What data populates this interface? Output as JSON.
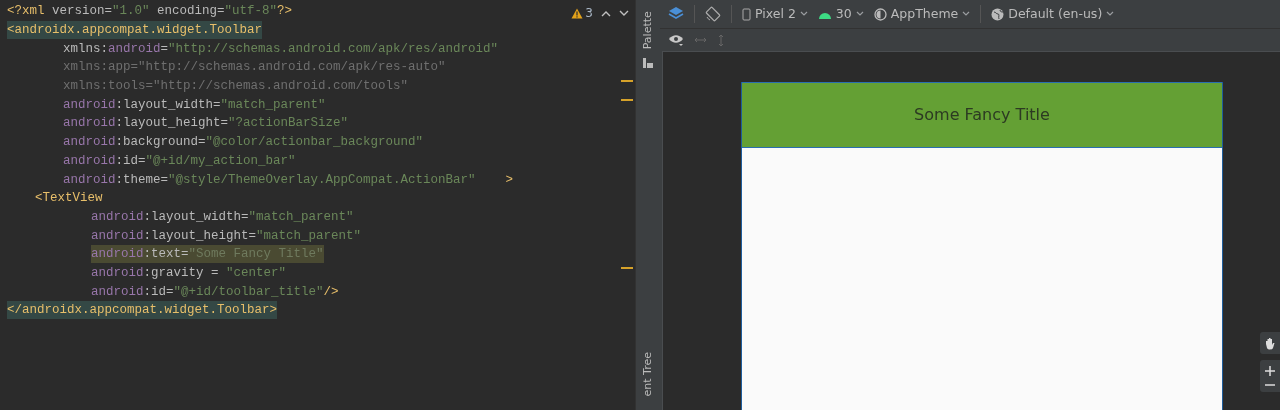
{
  "editor": {
    "warnings": {
      "count": "3"
    },
    "lines": [
      {
        "highlighted": false,
        "tokens": [
          {
            "kind": "tag",
            "text": "<?xml "
          },
          {
            "kind": "attr",
            "text": "version"
          },
          {
            "kind": "eq",
            "text": "="
          },
          {
            "kind": "str",
            "text": "\"1.0\""
          },
          {
            "kind": "attr",
            "text": " encoding"
          },
          {
            "kind": "eq",
            "text": "="
          },
          {
            "kind": "str",
            "text": "\"utf-8\""
          },
          {
            "kind": "tag",
            "text": "?>"
          }
        ]
      },
      {
        "highlighted": true,
        "tokens": [
          {
            "kind": "tag",
            "text": "<androidx.appcompat.widget.Toolbar"
          }
        ],
        "attributes": [
          {
            "highlighted": false,
            "tokens": [
              {
                "kind": "attr",
                "text": "xmlns:"
              },
              {
                "kind": "ns",
                "text": "android"
              },
              {
                "kind": "eq",
                "text": "="
              },
              {
                "kind": "str",
                "text": "\"http://schemas.android.com/apk/res/android\""
              }
            ]
          },
          {
            "highlighted": false,
            "tokens": [
              {
                "kind": "dim",
                "text": "xmlns:app=\"http://schemas.android.com/apk/res-auto\""
              }
            ]
          },
          {
            "highlighted": false,
            "tokens": [
              {
                "kind": "dim",
                "text": "xmlns:tools=\"http://schemas.android.com/tools\""
              }
            ]
          },
          {
            "highlighted": false,
            "tokens": [
              {
                "kind": "ns",
                "text": "android"
              },
              {
                "kind": "attr",
                "text": ":layout_width"
              },
              {
                "kind": "eq",
                "text": "="
              },
              {
                "kind": "str",
                "text": "\"match_parent\""
              }
            ]
          },
          {
            "highlighted": false,
            "tokens": [
              {
                "kind": "ns",
                "text": "android"
              },
              {
                "kind": "attr",
                "text": ":layout_height"
              },
              {
                "kind": "eq",
                "text": "="
              },
              {
                "kind": "str",
                "text": "\"?actionBarSize\""
              }
            ]
          },
          {
            "highlighted": false,
            "tokens": [
              {
                "kind": "ns",
                "text": "android"
              },
              {
                "kind": "attr",
                "text": ":background"
              },
              {
                "kind": "eq",
                "text": "="
              },
              {
                "kind": "str",
                "text": "\"@color/actionbar_background\""
              }
            ]
          },
          {
            "highlighted": false,
            "tokens": [
              {
                "kind": "ns",
                "text": "android"
              },
              {
                "kind": "attr",
                "text": ":id"
              },
              {
                "kind": "eq",
                "text": "="
              },
              {
                "kind": "str",
                "text": "\"@+id/my_action_bar\""
              }
            ]
          },
          {
            "highlighted": false,
            "tokens": [
              {
                "kind": "ns",
                "text": "android"
              },
              {
                "kind": "attr",
                "text": ":theme"
              },
              {
                "kind": "eq",
                "text": "="
              },
              {
                "kind": "str",
                "text": "\"@style/ThemeOverlay.AppCompat.ActionBar\"    "
              },
              {
                "kind": "tag",
                "text": ">"
              }
            ]
          }
        ],
        "children": [
          {
            "highlighted": false,
            "tokens": [
              {
                "kind": "tag",
                "text": "<TextView"
              }
            ],
            "attributes": [
              {
                "highlighted": false,
                "tokens": [
                  {
                    "kind": "ns",
                    "text": "android"
                  },
                  {
                    "kind": "attr",
                    "text": ":layout_width"
                  },
                  {
                    "kind": "eq",
                    "text": "="
                  },
                  {
                    "kind": "str",
                    "text": "\"match_parent\""
                  }
                ]
              },
              {
                "highlighted": false,
                "tokens": [
                  {
                    "kind": "ns",
                    "text": "android"
                  },
                  {
                    "kind": "attr",
                    "text": ":layout_height"
                  },
                  {
                    "kind": "eq",
                    "text": "="
                  },
                  {
                    "kind": "str",
                    "text": "\"match_parent\""
                  }
                ]
              },
              {
                "highlighted": true,
                "tokens": [
                  {
                    "kind": "ns",
                    "text": "android"
                  },
                  {
                    "kind": "attr",
                    "text": ":text"
                  },
                  {
                    "kind": "eq",
                    "text": "="
                  },
                  {
                    "kind": "dimstr",
                    "text": "\"Some Fancy Title\""
                  }
                ]
              },
              {
                "highlighted": false,
                "tokens": [
                  {
                    "kind": "ns",
                    "text": "android"
                  },
                  {
                    "kind": "attr",
                    "text": ":gravity = "
                  },
                  {
                    "kind": "str",
                    "text": "\"center\""
                  }
                ]
              },
              {
                "highlighted": false,
                "tokens": [
                  {
                    "kind": "ns",
                    "text": "android"
                  },
                  {
                    "kind": "attr",
                    "text": ":id"
                  },
                  {
                    "kind": "eq",
                    "text": "="
                  },
                  {
                    "kind": "str",
                    "text": "\"@+id/toolbar_title\""
                  },
                  {
                    "kind": "tag",
                    "text": "/>"
                  }
                ]
              }
            ]
          }
        ]
      },
      {
        "highlighted": true,
        "tokens": [
          {
            "kind": "tag",
            "text": "</androidx.appcompat.widget.Toolbar>"
          }
        ]
      }
    ]
  },
  "side_tabs": [
    "Palette",
    "ent Tree"
  ],
  "toolbar": {
    "device": "Pixel 2",
    "api": "30",
    "theme": "AppTheme",
    "locale": "Default (en-us)"
  },
  "preview": {
    "toolbar_title": "Some Fancy Title"
  }
}
